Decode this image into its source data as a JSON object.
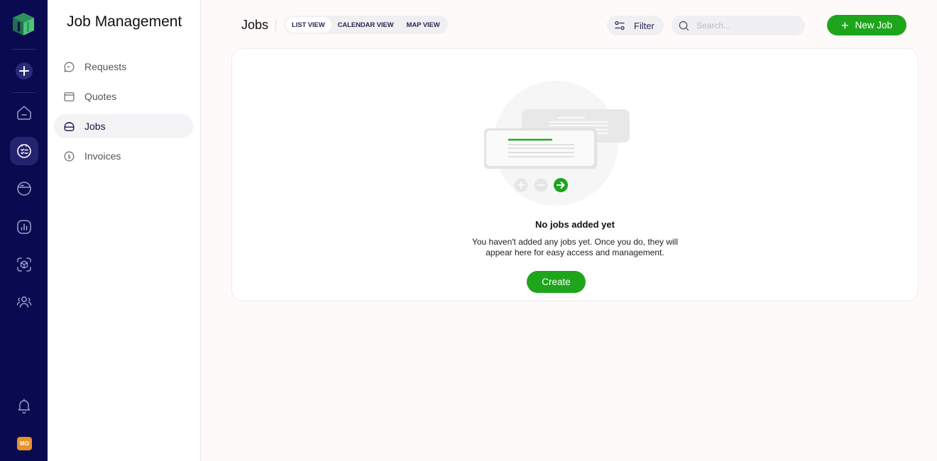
{
  "rail": {
    "logo": "app-logo-cube",
    "add_icon": "plus-icon",
    "nav": [
      {
        "icon": "home-icon",
        "active": false
      },
      {
        "icon": "jobs-clipboard-icon",
        "active": true
      },
      {
        "icon": "card-icon",
        "active": false
      },
      {
        "icon": "chart-icon",
        "active": false
      },
      {
        "icon": "box-scan-icon",
        "active": false
      },
      {
        "icon": "users-icon",
        "active": false
      }
    ],
    "bell_icon": "bell-icon",
    "avatar_initials": "MO",
    "avatar_color": "#e8922a"
  },
  "subnav": {
    "title": "Job Management",
    "items": [
      {
        "label": "Requests",
        "icon": "chat-icon",
        "active": false
      },
      {
        "label": "Quotes",
        "icon": "window-icon",
        "active": false
      },
      {
        "label": "Jobs",
        "icon": "toolbox-icon",
        "active": true
      },
      {
        "label": "Invoices",
        "icon": "dollar-icon",
        "active": false
      }
    ]
  },
  "topbar": {
    "title": "Jobs",
    "tabs": [
      {
        "label": "LIST VIEW",
        "active": true
      },
      {
        "label": "CALENDAR VIEW",
        "active": false
      },
      {
        "label": "MAP VIEW",
        "active": false
      }
    ],
    "filter_label": "Filter",
    "search_placeholder": "Search...",
    "search_value": "",
    "new_job_label": "New Job"
  },
  "empty_state": {
    "title": "No jobs added yet",
    "line1": "You haven't added any jobs yet. Once you do, they will",
    "line2": "appear here for easy access and management.",
    "create_label": "Create"
  },
  "colors": {
    "rail_bg": "#0a0a50",
    "accent_green": "#1ea51b",
    "page_bg": "#fdfaf9"
  }
}
